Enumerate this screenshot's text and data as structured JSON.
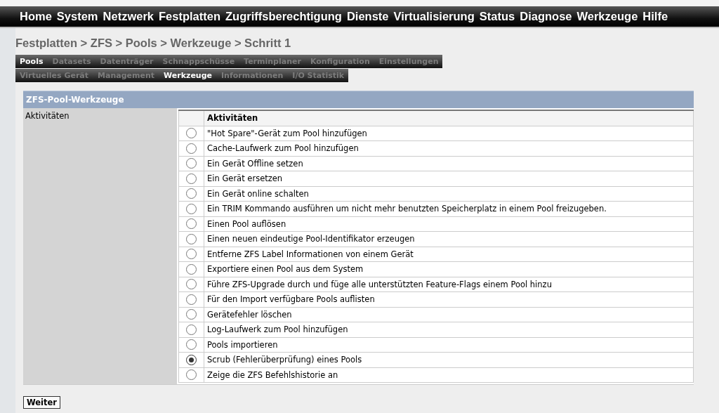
{
  "menu": [
    {
      "label": "Home"
    },
    {
      "label": "System"
    },
    {
      "label": "Netzwerk"
    },
    {
      "label": "Festplatten"
    },
    {
      "label": "Zugriffsberechtigung"
    },
    {
      "label": "Dienste"
    },
    {
      "label": "Virtualisierung"
    },
    {
      "label": "Status"
    },
    {
      "label": "Diagnose"
    },
    {
      "label": "Werkzeuge"
    },
    {
      "label": "Hilfe"
    }
  ],
  "breadcrumb": "Festplatten > ZFS > Pools > Werkzeuge > Schritt 1",
  "tabs": [
    {
      "label": "Pools",
      "selected": true
    },
    {
      "label": "Datasets",
      "selected": false
    },
    {
      "label": "Datenträger",
      "selected": false
    },
    {
      "label": "Schnappschüsse",
      "selected": false
    },
    {
      "label": "Terminplaner",
      "selected": false
    },
    {
      "label": "Konfiguration",
      "selected": false
    },
    {
      "label": "Einstellungen",
      "selected": false
    }
  ],
  "subtabs": [
    {
      "label": "Virtuelles Gerät",
      "selected": false
    },
    {
      "label": "Management",
      "selected": false
    },
    {
      "label": "Werkzeuge",
      "selected": true
    },
    {
      "label": "Informationen",
      "selected": false
    },
    {
      "label": "I/O Statistik",
      "selected": false
    }
  ],
  "panel": {
    "title": "ZFS-Pool-Werkzeuge",
    "field_label": "Aktivitäten",
    "column_header": "Aktivitäten",
    "options": [
      {
        "label": "\"Hot Spare\"-Gerät zum Pool hinzufügen",
        "selected": false
      },
      {
        "label": "Cache-Laufwerk zum Pool hinzufügen",
        "selected": false
      },
      {
        "label": "Ein Gerät Offline setzen",
        "selected": false
      },
      {
        "label": "Ein Gerät ersetzen",
        "selected": false
      },
      {
        "label": "Ein Gerät online schalten",
        "selected": false
      },
      {
        "label": "Ein TRIM Kommando ausführen um nicht mehr benutzten Speicherplatz in einem Pool freizugeben.",
        "selected": false
      },
      {
        "label": "Einen Pool auflösen",
        "selected": false
      },
      {
        "label": "Einen neuen eindeutige Pool-Identifikator erzeugen",
        "selected": false
      },
      {
        "label": "Entferne ZFS Label Informationen von einem Gerät",
        "selected": false
      },
      {
        "label": "Exportiere einen Pool aus dem System",
        "selected": false
      },
      {
        "label": "Führe ZFS-Upgrade durch und füge alle unterstützten Feature-Flags einem Pool hinzu",
        "selected": false
      },
      {
        "label": "Für den Import verfügbare Pools auflisten",
        "selected": false
      },
      {
        "label": "Gerätefehler löschen",
        "selected": false
      },
      {
        "label": "Log-Laufwerk zum Pool hinzufügen",
        "selected": false
      },
      {
        "label": "Pools importieren",
        "selected": false
      },
      {
        "label": "Scrub (Fehlerüberprüfung) eines Pools",
        "selected": true
      },
      {
        "label": "Zeige die ZFS Befehlshistorie an",
        "selected": false
      }
    ]
  },
  "button": "Weiter"
}
